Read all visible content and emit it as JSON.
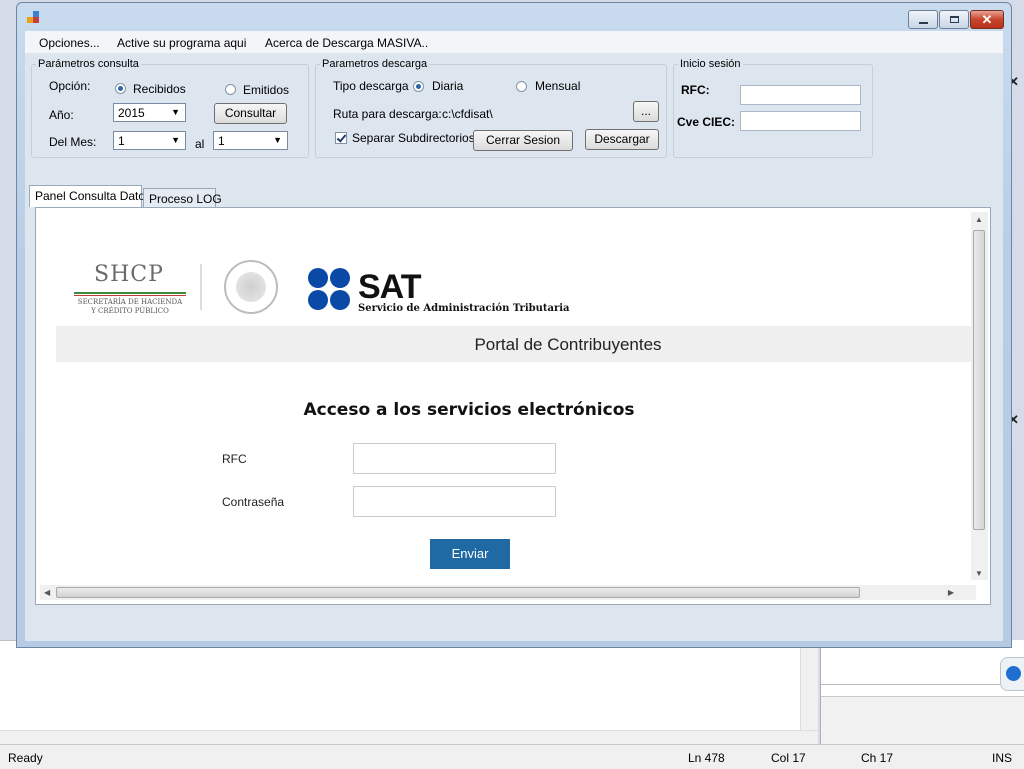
{
  "menu": {
    "opciones": "Opciones...",
    "activar": "Active su programa aqui",
    "acerca": "Acerca de Descarga MASIVA.."
  },
  "consulta": {
    "legend": "Parámetros consulta",
    "opcion_label": "Opción:",
    "recibidos": "Recibidos",
    "emitidos": "Emitidos",
    "anio_label": "Año:",
    "anio_value": "2015",
    "consultar": "Consultar",
    "mes_label": "Del Mes:",
    "mes_from": "1",
    "al_label": "al",
    "mes_to": "1",
    "selected_option": "Recibidos"
  },
  "descarga": {
    "legend": "Parametros descarga",
    "tipo_label": "Tipo descarga",
    "diaria": "Diaria",
    "mensual": "Mensual",
    "ruta_label": "Ruta para descarga:",
    "ruta_value": "c:\\cfdisat\\",
    "browse": "...",
    "separar": "Separar Subdirectorios",
    "separar_checked": true,
    "cerrar": "Cerrar Sesion",
    "descargar": "Descargar",
    "selected_tipo": "Diaria"
  },
  "sesion": {
    "legend": "Inicio sesión",
    "rfc_label": "RFC:",
    "ciec_label": "Cve CIEC:"
  },
  "tabs": [
    {
      "label": "Panel Consulta Datos",
      "active": true
    },
    {
      "label": "Proceso LOG",
      "active": false
    }
  ],
  "web": {
    "shcp": "SHCP",
    "shcp_sub1": "SECRETARÍA DE HACIENDA",
    "shcp_sub2": "Y CRÉDITO PÚBLICO",
    "sat": "SAT",
    "sat_sub": "Servicio de Administración Tributaria",
    "portal_title": "Portal de Contribuyentes",
    "access_title": "Acceso a los servicios electrónicos",
    "rfc_label": "RFC",
    "password_label": "Contraseña",
    "submit": "Enviar"
  },
  "statusbar": {
    "state": "Ready",
    "ln": "Ln 478",
    "col": "Col 17",
    "ch": "Ch 17",
    "mode": "INS"
  },
  "colors": {
    "accent_button": "#1f6aa5",
    "sat_blue": "#0b49a6",
    "window_frame": "#b8cee6",
    "close_red": "#c8442c"
  }
}
